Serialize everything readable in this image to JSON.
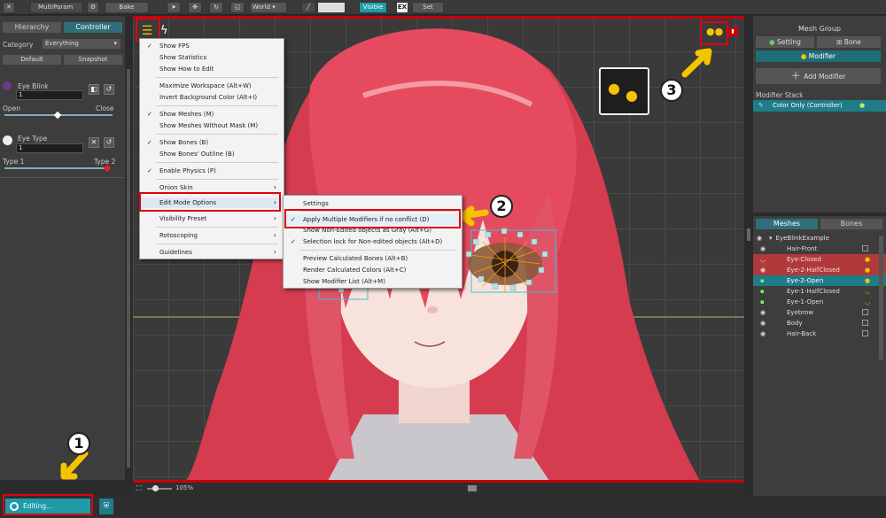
{
  "toolbar": {
    "close_label": "✕",
    "file_label": "MultiParam",
    "bake_label": "Bake",
    "space_label": "World",
    "visible_label": "Visible",
    "ex_label": "EX",
    "set_label": "Set"
  },
  "left": {
    "tabs": [
      "Hierarchy",
      "Controller"
    ],
    "category_label": "Category",
    "category_value": "Everything",
    "default_label": "Default",
    "snapshot_label": "Snapshot",
    "params": [
      {
        "name": "Eye Blink",
        "value": "1",
        "min_label": "Open",
        "max_label": "Close"
      },
      {
        "name": "Eye Type",
        "value": "1",
        "min_label": "Type 1",
        "max_label": "Type 2"
      }
    ]
  },
  "menu": {
    "items": [
      {
        "label": "Show FPS",
        "checked": true
      },
      {
        "label": "Show Statistics",
        "checked": false
      },
      {
        "label": "Show How to Edit",
        "checked": false
      },
      {
        "label": "Maximize Workspace (Alt+W)",
        "checked": false
      },
      {
        "label": "Invert Background Color (Alt+I)",
        "checked": false
      },
      {
        "label": "Show Meshes (M)",
        "checked": true
      },
      {
        "label": "Show Meshes Without Mask (M)",
        "checked": false
      },
      {
        "label": "Show Bones (B)",
        "checked": true
      },
      {
        "label": "Show Bones' Outline (B)",
        "checked": false
      },
      {
        "label": "Enable Physics (P)",
        "checked": true
      },
      {
        "label": "Onion Skin",
        "checked": false
      },
      {
        "label": "Edit Mode Options",
        "checked": false
      },
      {
        "label": "Visibility Preset",
        "checked": false
      },
      {
        "label": "Rotoscoping",
        "checked": false
      },
      {
        "label": "Guidelines",
        "checked": false
      }
    ],
    "submenu": [
      {
        "label": "Settings",
        "checked": false
      },
      {
        "label": "Apply Multiple Modifiers if no conflict (D)",
        "checked": true
      },
      {
        "label": "Show Non-Edited objects as Gray (Alt+G)",
        "checked": false
      },
      {
        "label": "Selection lock for Non-edited objects (Alt+D)",
        "checked": true
      },
      {
        "label": "Preview Calculated Bones (Alt+B)",
        "checked": false
      },
      {
        "label": "Render Calculated Colors (Alt+C)",
        "checked": false
      },
      {
        "label": "Show Modifier List (Alt+M)",
        "checked": false
      }
    ]
  },
  "annotations": [
    "1",
    "2",
    "3"
  ],
  "viewport": {
    "zoom": "105%"
  },
  "bottom": {
    "editing_label": "Editing..."
  },
  "right": {
    "title": "Mesh Group",
    "setting_label": "Setting",
    "bone_label": "Bone",
    "modifier_label": "Modifier",
    "add_modifier_label": "Add Modifier",
    "modifier_stack_label": "Modifier Stack",
    "modifier_item": "Color Only (Controller)",
    "tabs": [
      "Meshes",
      "Bones"
    ],
    "tree": [
      {
        "label": "EyeBlinkExample",
        "style": "root"
      },
      {
        "label": "Hair-Front",
        "style": "normal"
      },
      {
        "label": "Eye-Closed",
        "style": "red"
      },
      {
        "label": "Eye-2-HalfClosed",
        "style": "red"
      },
      {
        "label": "Eye-2-Open",
        "style": "teal"
      },
      {
        "label": "Eye-1-HalfClosed",
        "style": "normal"
      },
      {
        "label": "Eye-1-Open",
        "style": "normal"
      },
      {
        "label": "Eyebrow",
        "style": "normal"
      },
      {
        "label": "Body",
        "style": "normal"
      },
      {
        "label": "Hair-Back",
        "style": "normal"
      }
    ]
  },
  "colors": {
    "accent": "#1f7c88",
    "highlight": "#e00010",
    "arrow": "#f5c400",
    "hair": "#e8485a"
  }
}
